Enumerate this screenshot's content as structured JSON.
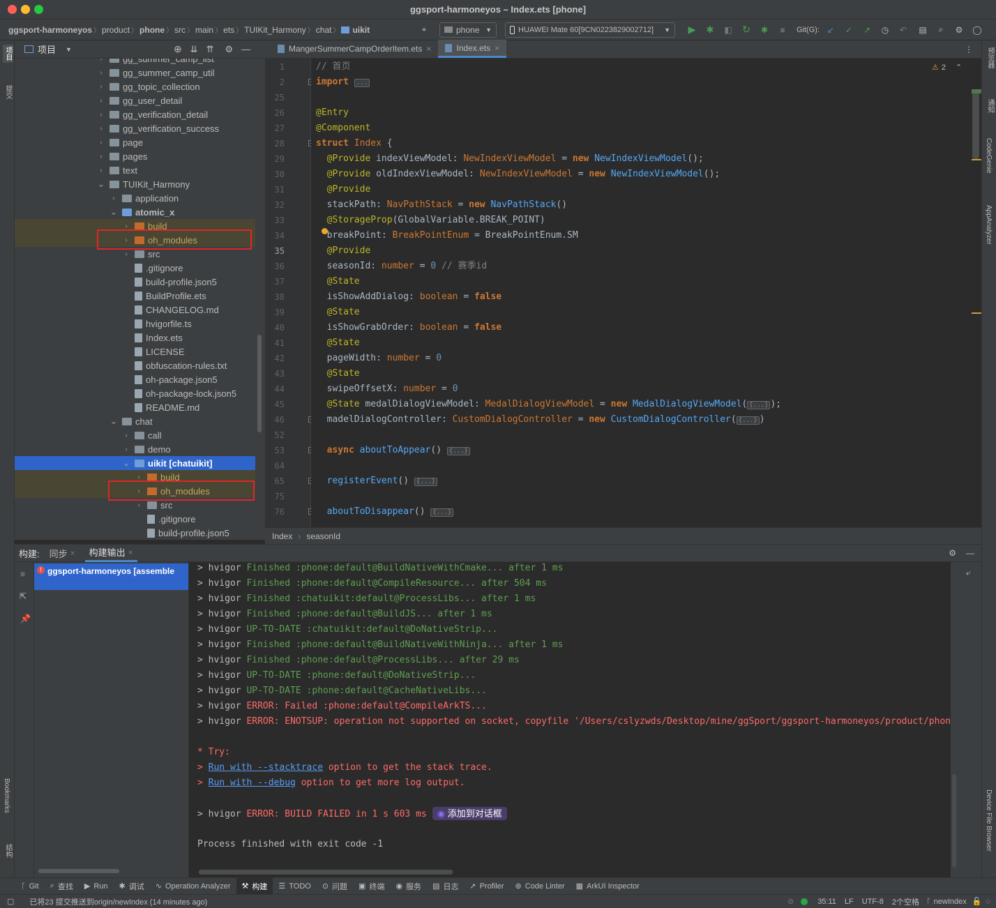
{
  "window": {
    "title": "ggsport-harmoneyos – Index.ets [phone]"
  },
  "breadcrumb": [
    "ggsport-harmoneyos",
    "product",
    "phone",
    "src",
    "main",
    "ets",
    "TUIKit_Harmony",
    "chat",
    "uikit"
  ],
  "toolbar": {
    "run_config": "phone",
    "device": "HUAWEI Mate 60[9CN0223829002712]",
    "git_label": "Git(G):"
  },
  "project_panel": {
    "title": "项目",
    "items": [
      {
        "label": "gg_summer_camp_list",
        "depth": 1,
        "type": "folder",
        "expanded": false
      },
      {
        "label": "gg_summer_camp_util",
        "depth": 1,
        "type": "folder",
        "expanded": false
      },
      {
        "label": "gg_topic_collection",
        "depth": 1,
        "type": "folder",
        "expanded": false
      },
      {
        "label": "gg_user_detail",
        "depth": 1,
        "type": "folder",
        "expanded": false
      },
      {
        "label": "gg_verification_detail",
        "depth": 1,
        "type": "folder",
        "expanded": false
      },
      {
        "label": "gg_verification_success",
        "depth": 1,
        "type": "folder",
        "expanded": false
      },
      {
        "label": "page",
        "depth": 1,
        "type": "folder",
        "expanded": false
      },
      {
        "label": "pages",
        "depth": 1,
        "type": "folder",
        "expanded": false
      },
      {
        "label": "text",
        "depth": 1,
        "type": "folder",
        "expanded": false
      },
      {
        "label": "TUIKit_Harmony",
        "depth": 1,
        "type": "folder",
        "expanded": true
      },
      {
        "label": "application",
        "depth": 2,
        "type": "folder",
        "expanded": false
      },
      {
        "label": "atomic_x",
        "depth": 2,
        "type": "module",
        "expanded": true
      },
      {
        "label": "build",
        "depth": 3,
        "type": "excluded",
        "expanded": false
      },
      {
        "label": "oh_modules",
        "depth": 3,
        "type": "excluded",
        "expanded": false
      },
      {
        "label": "src",
        "depth": 3,
        "type": "folder",
        "expanded": false
      },
      {
        "label": ".gitignore",
        "depth": 3,
        "type": "file"
      },
      {
        "label": "build-profile.json5",
        "depth": 3,
        "type": "file"
      },
      {
        "label": "BuildProfile.ets",
        "depth": 3,
        "type": "file"
      },
      {
        "label": "CHANGELOG.md",
        "depth": 3,
        "type": "file"
      },
      {
        "label": "hvigorfile.ts",
        "depth": 3,
        "type": "file"
      },
      {
        "label": "Index.ets",
        "depth": 3,
        "type": "file"
      },
      {
        "label": "LICENSE",
        "depth": 3,
        "type": "file"
      },
      {
        "label": "obfuscation-rules.txt",
        "depth": 3,
        "type": "file"
      },
      {
        "label": "oh-package.json5",
        "depth": 3,
        "type": "file"
      },
      {
        "label": "oh-package-lock.json5",
        "depth": 3,
        "type": "file"
      },
      {
        "label": "README.md",
        "depth": 3,
        "type": "file"
      },
      {
        "label": "chat",
        "depth": 2,
        "type": "folder",
        "expanded": true
      },
      {
        "label": "call",
        "depth": 3,
        "type": "folder",
        "expanded": false
      },
      {
        "label": "demo",
        "depth": 3,
        "type": "folder",
        "expanded": false
      },
      {
        "label": "uikit [chatuikit]",
        "depth": 3,
        "type": "module",
        "expanded": true,
        "selected": true
      },
      {
        "label": "build",
        "depth": 4,
        "type": "excluded",
        "expanded": false
      },
      {
        "label": "oh_modules",
        "depth": 4,
        "type": "excluded",
        "expanded": false
      },
      {
        "label": "src",
        "depth": 4,
        "type": "folder",
        "expanded": false
      },
      {
        "label": ".gitignore",
        "depth": 4,
        "type": "file"
      },
      {
        "label": "build-profile.json5",
        "depth": 4,
        "type": "file"
      }
    ]
  },
  "editor": {
    "tabs": [
      {
        "label": "MangerSummerCampOrderItem.ets",
        "active": false
      },
      {
        "label": "Index.ets",
        "active": true
      }
    ],
    "warnings": "2",
    "current_line": "35",
    "lines": [
      {
        "n": "1",
        "html": "<span class='cmt'>// 首页</span>"
      },
      {
        "n": "2",
        "html": "<span class='kw'>import</span> <span class='fold-mark'>...</span>"
      },
      {
        "n": "25",
        "html": ""
      },
      {
        "n": "26",
        "html": "<span class='an'>@Entry</span>"
      },
      {
        "n": "27",
        "html": "<span class='an'>@Component</span>"
      },
      {
        "n": "28",
        "html": "<span class='kw'>struct</span> <span class='ty' style='font-weight:normal'>Index</span> {"
      },
      {
        "n": "29",
        "html": "  <span class='an'>@Provide</span> indexViewModel: <span class='ty'>NewIndexViewModel</span> = <span class='kw'>new</span> <span class='blu'>NewIndexViewModel</span>();"
      },
      {
        "n": "30",
        "html": "  <span class='an'>@Provide</span> oldIndexViewModel: <span class='ty'>NewIndexViewModel</span> = <span class='kw'>new</span> <span class='blu'>NewIndexViewModel</span>();"
      },
      {
        "n": "31",
        "html": "  <span class='an'>@Provide</span>"
      },
      {
        "n": "32",
        "html": "  stackPath: <span class='ty'>NavPathStack</span> = <span class='kw'>new</span> <span class='blu'>NavPathStack</span>()"
      },
      {
        "n": "33",
        "html": "  <span class='an'>@StorageProp</span>(GlobalVariable.BREAK_POINT)"
      },
      {
        "n": "34",
        "html": "  breakPoint: <span class='ty'>BreakPointEnum</span> = BreakPointEnum.SM"
      },
      {
        "n": "35",
        "html": "  <span class='an'>@Provide</span>"
      },
      {
        "n": "36",
        "html": "  seasonId: <span class='ty'>number</span> = <span class='nm'>0</span> <span class='cmt'>// 赛季id</span>"
      },
      {
        "n": "37",
        "html": "  <span class='an'>@State</span>"
      },
      {
        "n": "38",
        "html": "  isShowAddDialog: <span class='ty'>boolean</span> = <span class='kw'>false</span>"
      },
      {
        "n": "39",
        "html": "  <span class='an'>@State</span>"
      },
      {
        "n": "40",
        "html": "  isShowGrabOrder: <span class='ty'>boolean</span> = <span class='kw'>false</span>"
      },
      {
        "n": "41",
        "html": "  <span class='an'>@State</span>"
      },
      {
        "n": "42",
        "html": "  pageWidth: <span class='ty'>number</span> = <span class='nm'>0</span>"
      },
      {
        "n": "43",
        "html": "  <span class='an'>@State</span>"
      },
      {
        "n": "44",
        "html": "  swipeOffsetX: <span class='ty'>number</span> = <span class='nm'>0</span>"
      },
      {
        "n": "45",
        "html": "  <span class='an'>@State</span> medalDialogViewModel: <span class='ty'>MedalDialogViewModel</span> = <span class='kw'>new</span> <span class='blu'>MedalDialogViewModel</span>(<span class='fold-mark'>[...]</span>);"
      },
      {
        "n": "46",
        "html": "  madelDialogController: <span class='ty'>CustomDialogController</span> = <span class='kw'>new</span> <span class='blu'>CustomDialogController</span>(<span class='fold-mark'>{...}</span>)"
      },
      {
        "n": "52",
        "html": ""
      },
      {
        "n": "53",
        "html": "  <span class='kw'>async</span> <span class='blu'>aboutToAppear</span>() <span class='fold-mark'>{...}</span>"
      },
      {
        "n": "64",
        "html": ""
      },
      {
        "n": "65",
        "html": "  <span class='blu'>registerEvent</span>() <span class='fold-mark'>{...}</span>"
      },
      {
        "n": "75",
        "html": ""
      },
      {
        "n": "76",
        "html": "  <span class='blu'>aboutToDisappear</span>() <span class='fold-mark'>{...}</span>"
      }
    ],
    "breadcrumbs": [
      "Index",
      "seasonId"
    ]
  },
  "build_panel": {
    "header_label": "构建:",
    "tabs": [
      "同步",
      "构建输出"
    ],
    "task": "ggsport-harmoneyos [assemble",
    "output": [
      {
        "pre": "> hvigor ",
        "cls": "grn",
        "text": "Finished :phone:default@BuildNativeWithCmake... after 1 ms"
      },
      {
        "pre": "> hvigor ",
        "cls": "grn",
        "text": "Finished :phone:default@CompileResource... after 504 ms"
      },
      {
        "pre": "> hvigor ",
        "cls": "grn",
        "text": "Finished :chatuikit:default@ProcessLibs... after 1 ms"
      },
      {
        "pre": "> hvigor ",
        "cls": "grn",
        "text": "Finished :phone:default@BuildJS... after 1 ms"
      },
      {
        "pre": "> hvigor ",
        "cls": "grn",
        "text": "UP-TO-DATE :chatuikit:default@DoNativeStrip..."
      },
      {
        "pre": "> hvigor ",
        "cls": "grn",
        "text": "Finished :phone:default@BuildNativeWithNinja... after 1 ms"
      },
      {
        "pre": "> hvigor ",
        "cls": "grn",
        "text": "Finished :phone:default@ProcessLibs... after 29 ms"
      },
      {
        "pre": "> hvigor ",
        "cls": "grn",
        "text": "UP-TO-DATE :phone:default@DoNativeStrip..."
      },
      {
        "pre": "> hvigor ",
        "cls": "grn",
        "text": "UP-TO-DATE :phone:default@CacheNativeLibs..."
      },
      {
        "pre": "> hvigor ",
        "cls": "red",
        "text": "ERROR: Failed :phone:default@CompileArkTS..."
      },
      {
        "pre": "> hvigor ",
        "cls": "red",
        "text": "ERROR: ENOTSUP: operation not supported on socket, copyfile '/Users/cslyzwds/Desktop/mine/ggSport/ggsport-harmoneyos/product/phone"
      }
    ],
    "try_label": "* Try:",
    "try_lines": [
      {
        "link": "Run with --stacktrace",
        "rest": " option to get the stack trace."
      },
      {
        "link": "Run with --debug",
        "rest": " option to get more log output."
      }
    ],
    "failed_pre": "> hvigor ",
    "failed_text": "ERROR: BUILD FAILED in 1 s 603 ms",
    "add_to_chat": "添加到对话框",
    "exit_line": "Process finished with exit code -1"
  },
  "tool_tabs": [
    "Git",
    "查找",
    "Run",
    "调试",
    "Operation Analyzer",
    "构建",
    "TODO",
    "问题",
    "终端",
    "服务",
    "日志",
    "Profiler",
    "Code Linter",
    "ArkUI Inspector"
  ],
  "active_tool_tab": "构建",
  "left_strip": [
    "项目",
    "提交",
    "Bookmarks",
    "结构"
  ],
  "right_strip": [
    "预览器",
    "通知",
    "CodeGenie",
    "AppAnalyzer",
    "Device File Browser"
  ],
  "status": {
    "message": "已将23 提交推送到origin/newIndex (14 minutes ago)",
    "position": "35:11",
    "line_sep": "LF",
    "encoding": "UTF-8",
    "indent": "2个空格",
    "branch": "newIndex"
  },
  "colors": {
    "accent": "#2f65ca",
    "error": "#ff6b68",
    "success": "#5f9f52",
    "annotation_box": "#e02626"
  }
}
